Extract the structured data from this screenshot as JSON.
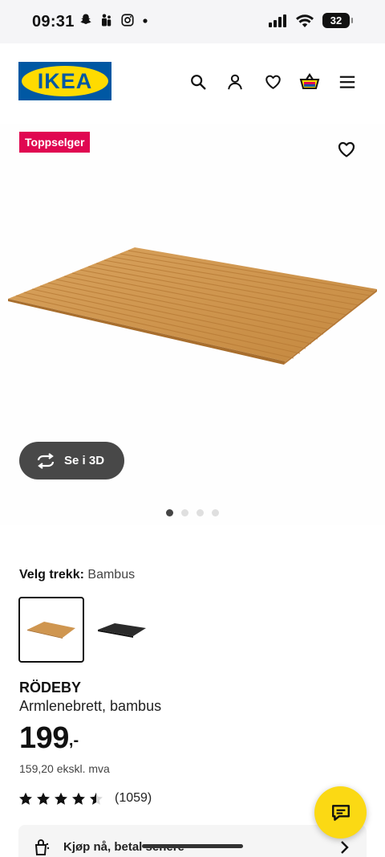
{
  "status_bar": {
    "time": "09:31",
    "battery": "32"
  },
  "header": {
    "logo_text": "IKEA",
    "icons": [
      "search-icon",
      "profile-icon",
      "heart-icon",
      "basket-icon",
      "menu-icon"
    ]
  },
  "product_media": {
    "badge": "Toppselger",
    "view_3d_label": "Se i 3D",
    "image_count": 4,
    "active_image": 0
  },
  "variant": {
    "label": "Velg trekk:",
    "value": "Bambus",
    "options": [
      "Bambus",
      "Svart"
    ]
  },
  "product": {
    "name": "RÖDEBY",
    "description": "Armlenebrett, bambus",
    "price_integer": "199",
    "price_suffix": ",-",
    "price_ex_vat": "159,20 ekskl. mva",
    "rating_stars": 4.5,
    "rating_count": "(1059)"
  },
  "pay_later": {
    "label": "Kjøp nå, betal senere"
  },
  "colors": {
    "brand_blue": "#0058a3",
    "brand_yellow": "#ffdb00",
    "badge_red": "#e00751",
    "chat_yellow": "#fbd914"
  }
}
